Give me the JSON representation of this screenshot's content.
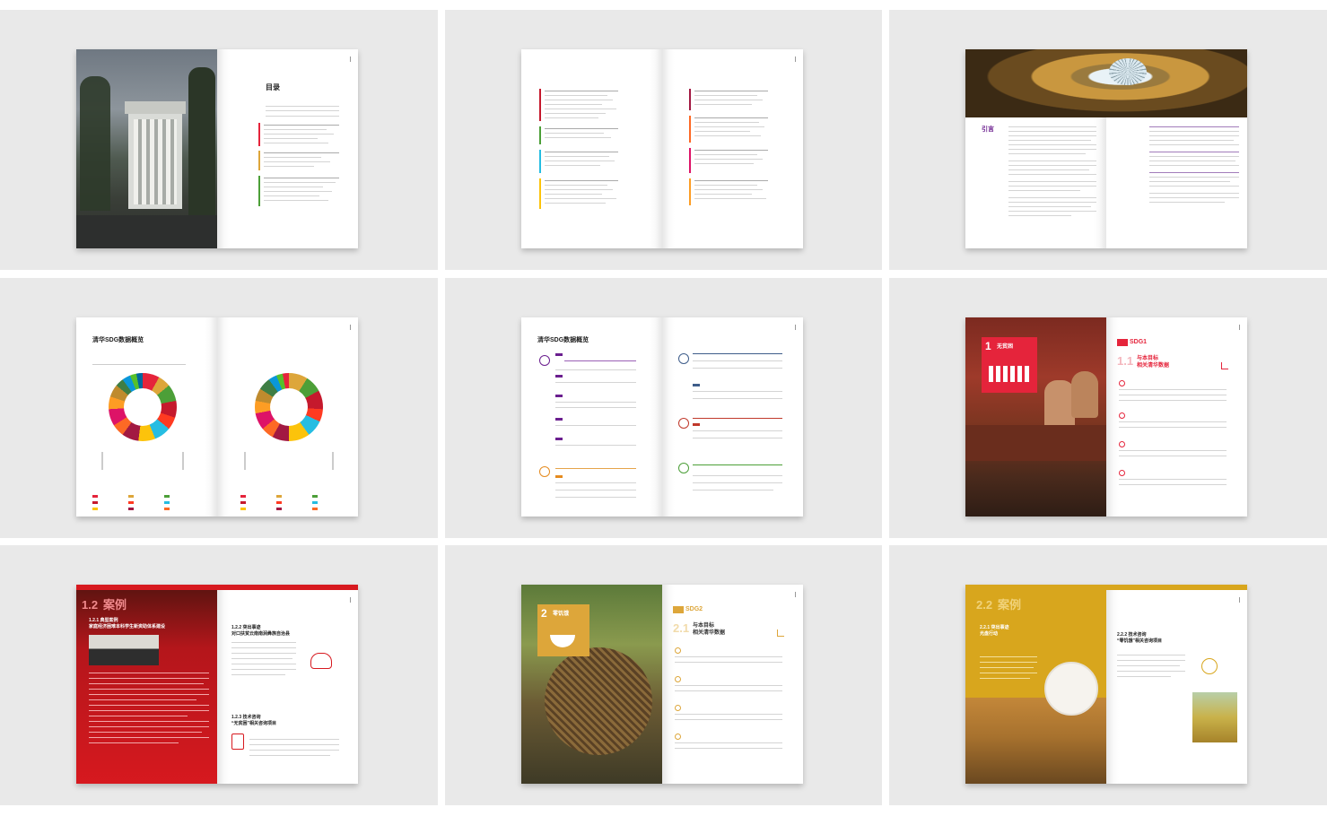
{
  "colors": {
    "background": "#e9e9e9",
    "red": "#d7191f",
    "yellow": "#d8a61d",
    "purple": "#6b1f8f",
    "sdg1_red": "#e5243b",
    "sdg2_gold": "#dda63a"
  },
  "spreads": [
    {
      "id": "toc",
      "title": "目录"
    },
    {
      "id": "toc-continued"
    },
    {
      "id": "introduction",
      "title": "引言"
    },
    {
      "id": "data-overview-charts",
      "title": "清华SDG数据概览"
    },
    {
      "id": "data-overview-lists",
      "title": "清华SDG数据概览"
    },
    {
      "id": "sdg1-opener",
      "badge_number": "1",
      "badge_label": "无贫困",
      "tag": "SDG1",
      "section_number": "1.1",
      "section_title_1": "与本目标",
      "section_title_2": "相关清华数据"
    },
    {
      "id": "case-1-2",
      "section_number": "1.2",
      "section_label": "案例",
      "heading_a": "1.2.1 典型案例",
      "heading_a2": "家庭经济困难本科学生新资助体系建设",
      "heading_b": "1.2.2 突出事迹",
      "heading_b2": "对口扶贫云南南涧彝族自治县",
      "heading_c": "1.2.3 技术咨询",
      "heading_c2": "“无贫困”相关咨询项目"
    },
    {
      "id": "sdg2-opener",
      "badge_number": "2",
      "badge_label": "零饥饿",
      "tag": "SDG2",
      "section_number": "2.1",
      "section_title_1": "与本目标",
      "section_title_2": "相关清华数据"
    },
    {
      "id": "case-2-2",
      "section_number": "2.2",
      "section_label": "案例",
      "heading_a": "2.2.1 突出事迹",
      "heading_a2": "光盘行动",
      "heading_b": "2.2.2 技术咨询",
      "heading_b2": "“零饥饿”相关咨询项目"
    }
  ]
}
